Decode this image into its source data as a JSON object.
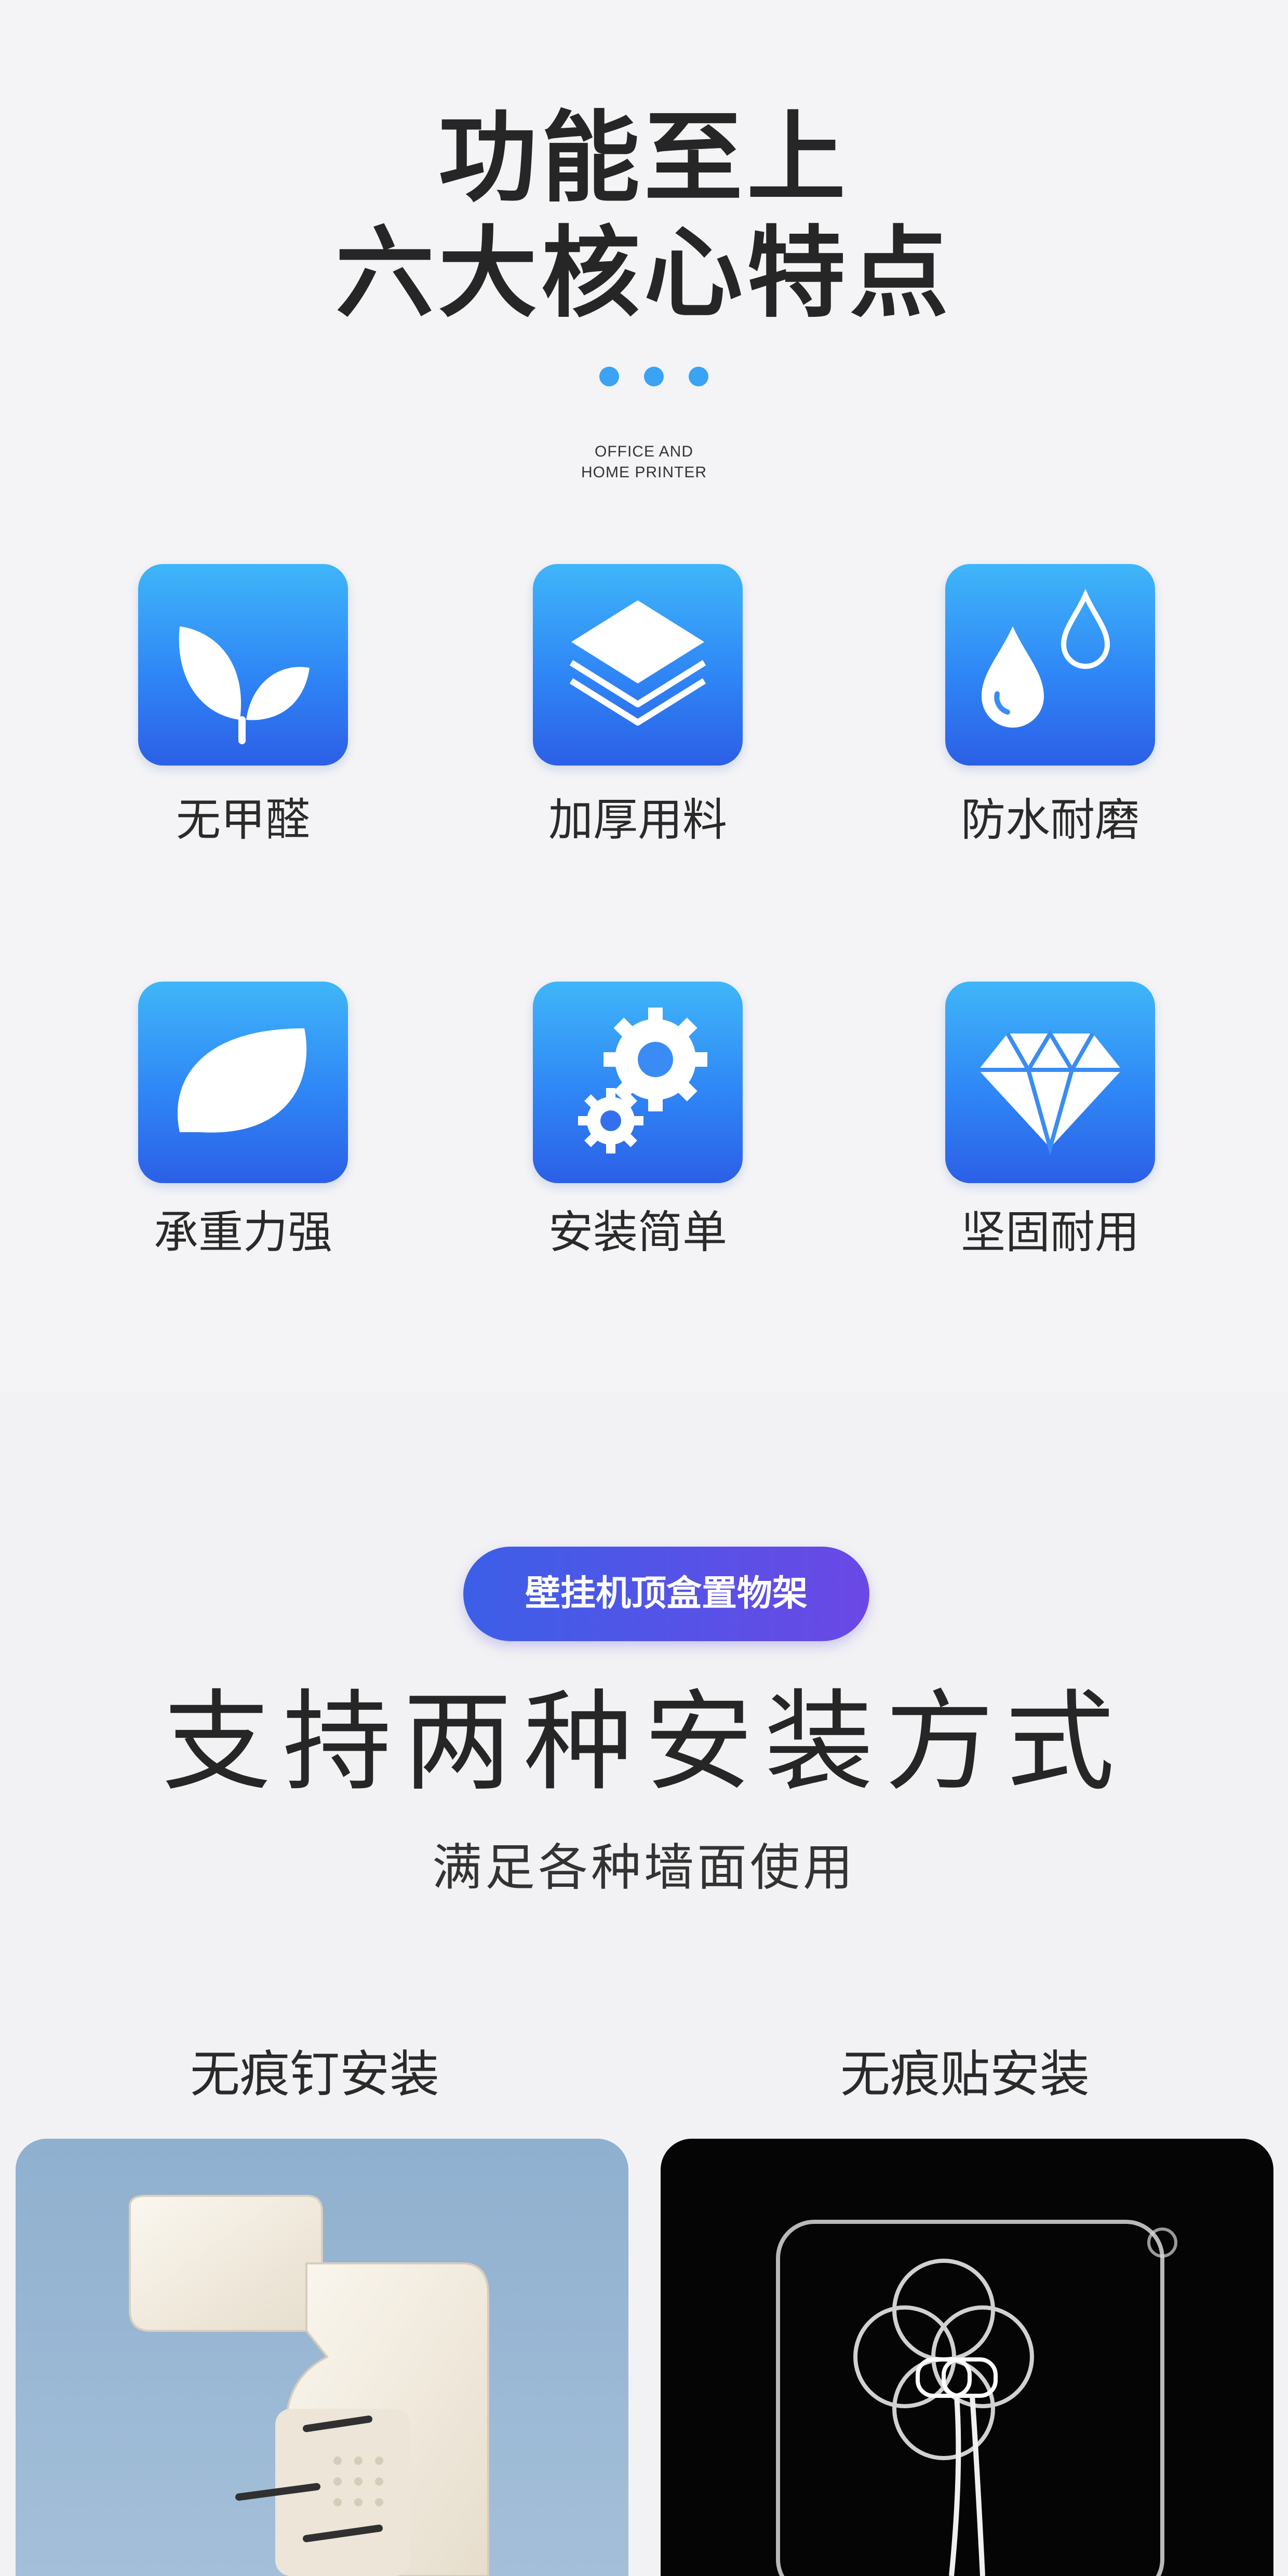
{
  "header": {
    "title_line1": "功能至上",
    "title_line2": "六大核心特点",
    "subtitle_en_line1": "OFFICE AND",
    "subtitle_en_line2": "HOME PRINTER",
    "dot_color": "#3aa3f4"
  },
  "features": [
    {
      "label": "无甲醛",
      "icon": "leaf-sprout-icon"
    },
    {
      "label": "加厚用料",
      "icon": "stacked-layers-icon"
    },
    {
      "label": "防水耐磨",
      "icon": "water-drops-icon"
    },
    {
      "label": "承重力强",
      "icon": "leaf-icon"
    },
    {
      "label": "安装简单",
      "icon": "gears-icon"
    },
    {
      "label": "坚固耐用",
      "icon": "diamond-icon"
    }
  ],
  "install": {
    "badge": "壁挂机顶盒置物架",
    "headline": "支持两种安装方式",
    "subheadline": "满足各种墙面使用",
    "methods": [
      {
        "label": "无痕钉安装"
      },
      {
        "label": "无痕贴安装"
      }
    ]
  },
  "colors": {
    "icon_gradient_top": "#3fb6f9",
    "icon_gradient_bottom": "#2c5fe6",
    "badge_gradient_left": "#3c5fe8",
    "badge_gradient_right": "#6b48e6"
  }
}
